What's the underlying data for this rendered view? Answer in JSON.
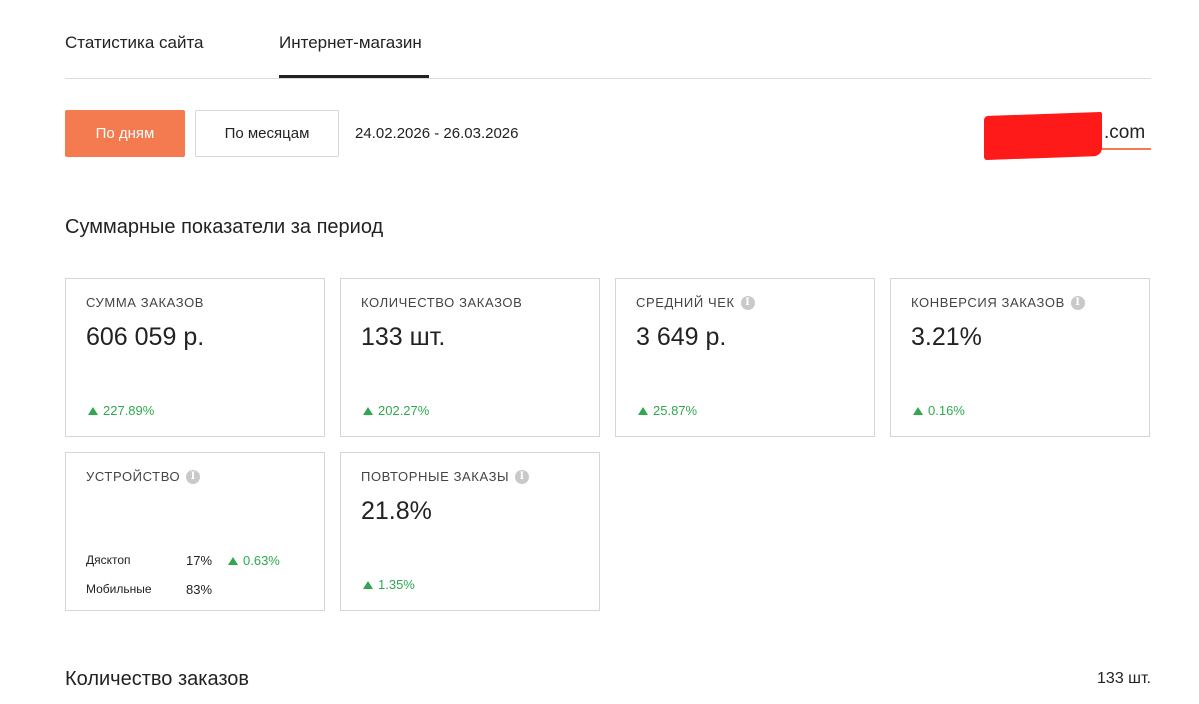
{
  "tabs": [
    {
      "label": "Статистика сайта",
      "active": false
    },
    {
      "label": "Интернет-магазин",
      "active": true
    }
  ],
  "period": {
    "btn_days": "По дням",
    "btn_months": "По месяцам",
    "range": "24.02.2026 - 26.03.2026"
  },
  "site": {
    "suffix": ".com"
  },
  "summary_title": "Суммарные показатели за период",
  "cards": {
    "sum": {
      "label": "Сумма заказов",
      "value": "606 059 р.",
      "delta": "227.89%"
    },
    "count": {
      "label": "Количество заказов",
      "value": "133 шт.",
      "delta": "202.27%"
    },
    "avg": {
      "label": "Средний чек",
      "value": "3 649 р.",
      "delta": "25.87%"
    },
    "conv": {
      "label": "Конверсия заказов",
      "value": "3.21%",
      "delta": "0.16%"
    },
    "device": {
      "label": "Устройство",
      "rows": [
        {
          "name": "Дясктоп",
          "value": "17%",
          "delta": "0.63%"
        },
        {
          "name": "Мобильные",
          "value": "83%",
          "delta": ""
        }
      ]
    },
    "repeat": {
      "label": "Повторные заказы",
      "value": "21.8%",
      "delta": "1.35%"
    }
  },
  "footer": {
    "title": "Количество заказов",
    "count": "133 шт."
  },
  "colors": {
    "accent": "#f47b4f",
    "positive": "#2fa84f",
    "border": "#d6d6d6"
  }
}
